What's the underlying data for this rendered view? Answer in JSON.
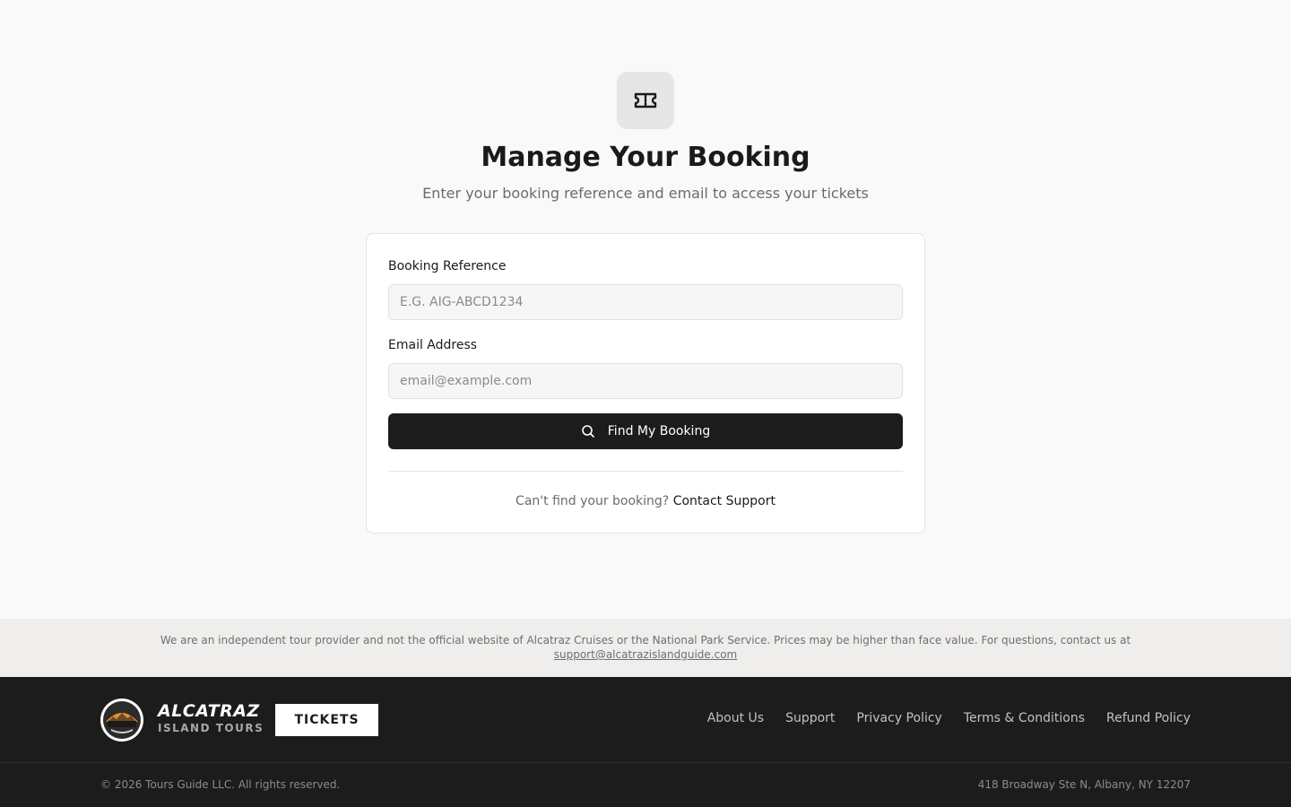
{
  "page": {
    "title": "Manage Your Booking",
    "subtitle": "Enter your booking reference and email to access your tickets",
    "icon": "ticket-icon"
  },
  "form": {
    "booking_ref_label": "Booking Reference",
    "booking_ref_placeholder": "E.G. AIG-ABCD1234",
    "booking_ref_value": "",
    "email_label": "Email Address",
    "email_placeholder": "email@example.com",
    "email_value": "",
    "submit_label": "Find My Booking",
    "submit_icon": "search-icon"
  },
  "help": {
    "text": "Can't find your booking?",
    "link_label": "Contact Support"
  },
  "disclaimer": {
    "text": "We are an independent tour provider and not the official website of Alcatraz Cruises or the National Park Service. Prices may be higher than face value. For questions, contact us at",
    "email": "support@alcatrazislandguide.com"
  },
  "footer": {
    "brand_name": "ALCATRAZ",
    "brand_sub": "ISLAND TOURS",
    "logo_text": "ALCATRAZ ISLAND",
    "tickets_label": "TICKETS",
    "nav": [
      "About Us",
      "Support",
      "Privacy Policy",
      "Terms & Conditions",
      "Refund Policy"
    ],
    "copyright": "© 2026 Tours Guide LLC. All rights reserved.",
    "address": "418 Broadway Ste N, Albany, NY 12207"
  },
  "colors": {
    "background": "#f9f9f9",
    "primary_button": "#1c1c1c",
    "footer_bg": "#1c1c1c",
    "disclaimer_bg": "#efeeec"
  }
}
